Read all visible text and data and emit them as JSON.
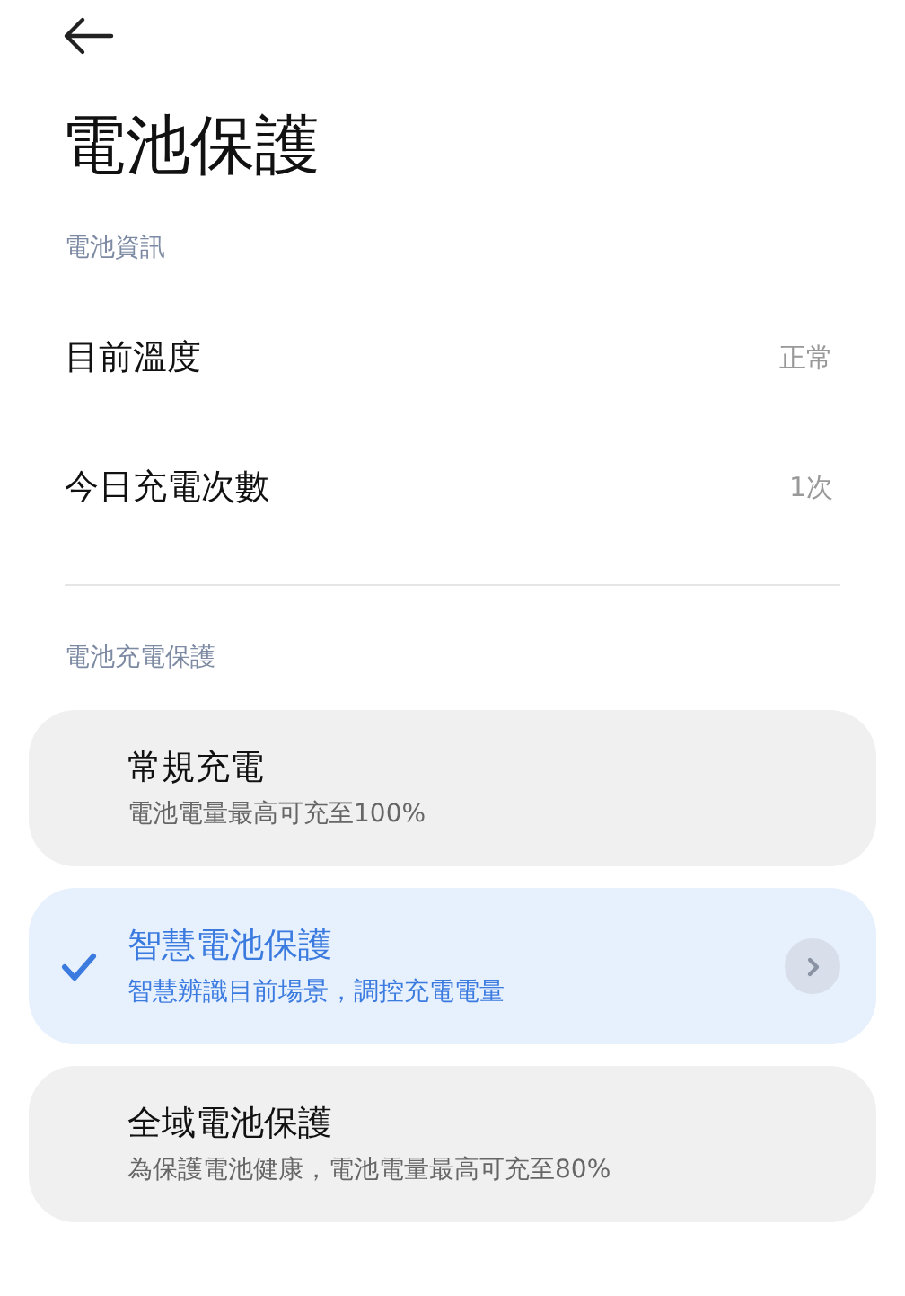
{
  "title": "電池保護",
  "battery_info": {
    "label": "電池資訊",
    "rows": [
      {
        "label": "目前溫度",
        "value": "正常"
      },
      {
        "label": "今日充電次數",
        "value": "1次"
      }
    ]
  },
  "charging_protection": {
    "label": "電池充電保護",
    "options": [
      {
        "title": "常規充電",
        "description": "電池電量最高可充至100%",
        "selected": false,
        "chevron": false
      },
      {
        "title": "智慧電池保護",
        "description": "智慧辨識目前場景，調控充電電量",
        "selected": true,
        "chevron": true
      },
      {
        "title": "全域電池保護",
        "description": "為保護電池健康，電池電量最高可充至80%",
        "selected": false,
        "chevron": false
      }
    ]
  }
}
